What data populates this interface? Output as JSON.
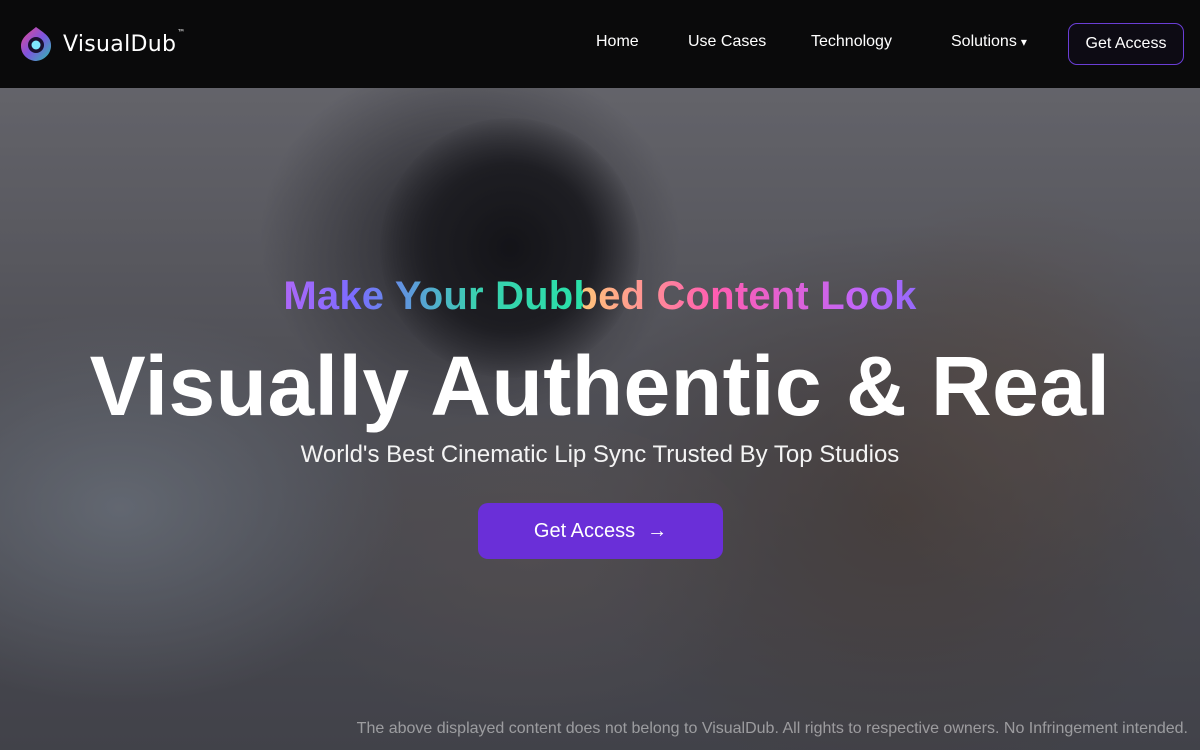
{
  "brand": {
    "name": "VisualDub",
    "tm": "™",
    "logo_icon": "visualdub-logo-icon"
  },
  "nav": {
    "links": [
      "Home",
      "Use Cases",
      "Technology",
      "Solutions"
    ],
    "solutions_caret": "▾",
    "cta": "Get Access"
  },
  "hero": {
    "tagline": "Make Your Dubbed Content Look",
    "headline": "Visually Authentic & Real",
    "subline": "World's Best Cinematic Lip Sync Trusted By Top Studios",
    "cta": "Get Access",
    "cta_arrow": "→",
    "cta_icon": "arrow-right-icon",
    "disclaimer": "The above displayed content does not belong to VisualDub. All rights to respective owners. No Infringement intended."
  },
  "colors": {
    "accent": "#6a2fd8",
    "nav_bg": "#0a0a0b",
    "cta_border": "#6a3ed6"
  }
}
